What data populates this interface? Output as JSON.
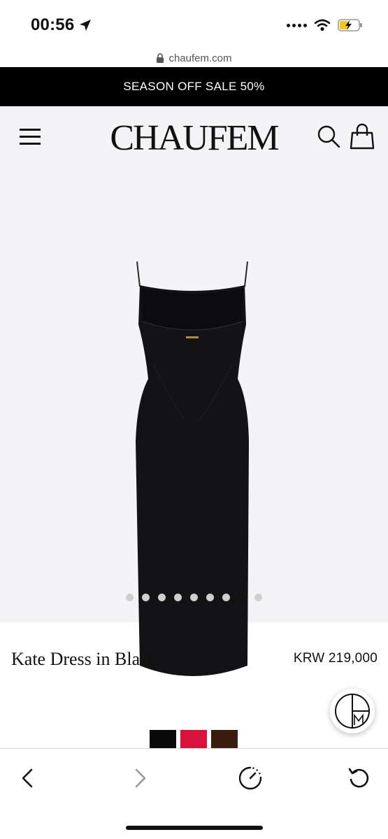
{
  "status_bar": {
    "time": "00:56",
    "icons": [
      "location-arrow-icon",
      "cellular-signal-icon",
      "wifi-icon",
      "battery-charging-icon"
    ]
  },
  "browser": {
    "url": "chaufem.com",
    "toolbar": [
      "back-icon",
      "forward-icon",
      "speed-dial-icon",
      "reload-icon"
    ]
  },
  "promo_banner": {
    "text": "SEASON OFF SALE 50%"
  },
  "header": {
    "logo": "CHAUFEM",
    "icons": [
      "hamburger-menu-icon",
      "search-icon",
      "shopping-bag-icon"
    ]
  },
  "gallery": {
    "image_count": 9,
    "active_index": 7
  },
  "product": {
    "name": "Kate Dress in Black",
    "price": "KRW 219,000"
  },
  "swatches": {
    "colors": [
      "#0a0a0a",
      "#d8123a",
      "#3a1d0e"
    ]
  },
  "colors": {
    "banner_bg": "#000000",
    "product_bg": "#f4f4f6",
    "dress": "#131316"
  }
}
